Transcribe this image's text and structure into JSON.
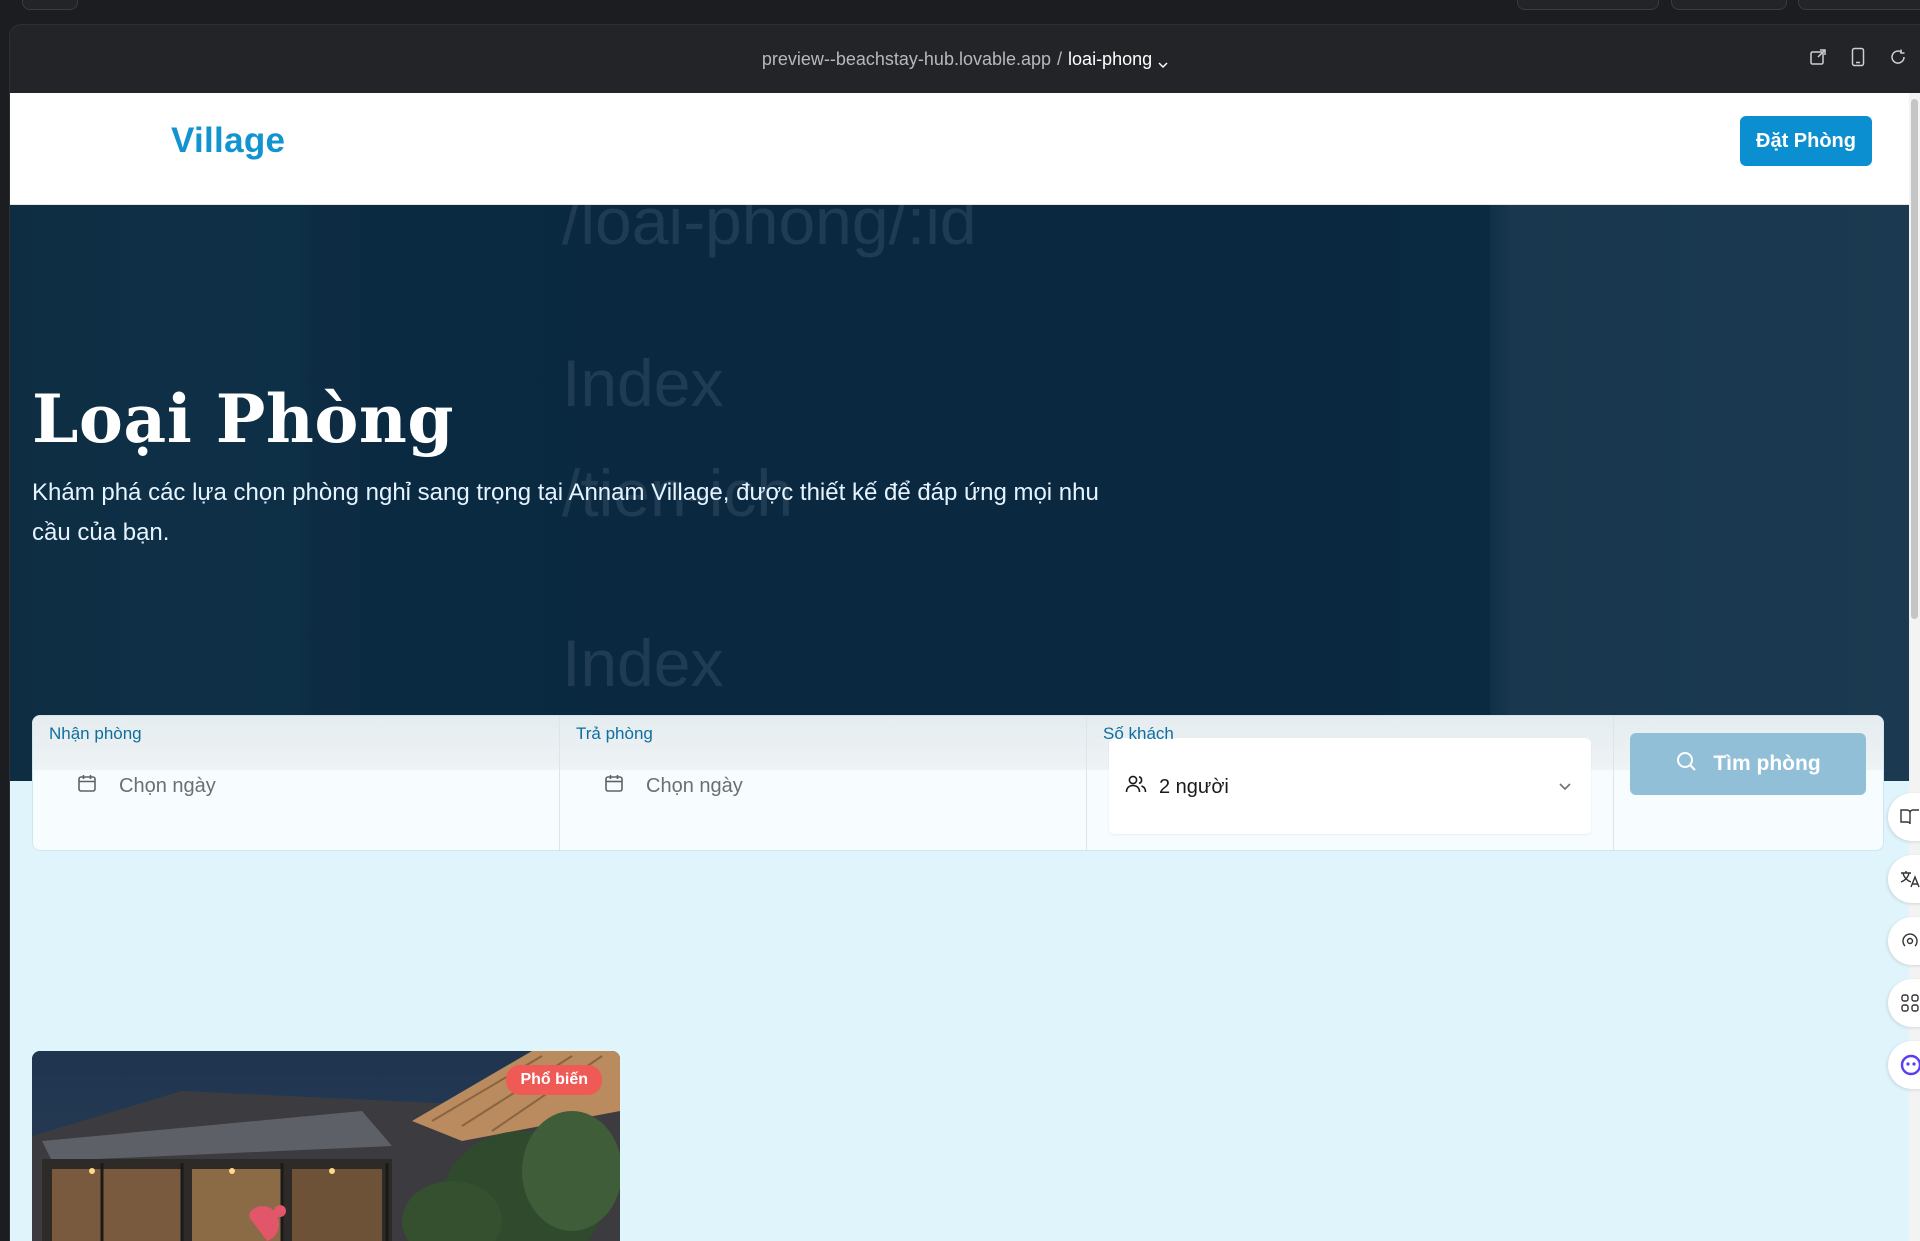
{
  "browser": {
    "url_host": "preview--beachstay-hub.lovable.app",
    "url_separator": "/",
    "url_path": "loai-phong"
  },
  "header": {
    "logo": "Village",
    "book_button": "Đặt Phòng"
  },
  "hero": {
    "title": "Loại Phòng",
    "subtitle": "Khám phá các lựa chọn phòng nghỉ sang trọng tại Annam Village, được thiết kế để đáp ứng mọi nhu cầu của bạn.",
    "ghost_texts": [
      "/loai-phong/:id",
      "Index",
      "/tien-ich",
      "Index"
    ]
  },
  "search": {
    "checkin_label": "Nhận phòng",
    "checkin_placeholder": "Chọn ngày",
    "checkout_label": "Trả phòng",
    "checkout_placeholder": "Chọn ngày",
    "guests_label": "Số khách",
    "guests_value": "2 người",
    "submit_label": "Tìm phòng"
  },
  "rooms": [
    {
      "badge": "Phổ biến"
    }
  ],
  "colors": {
    "brand": "#0b8fd0",
    "hero_bg": "#0a2a42",
    "page_bg": "#e0f5fb",
    "badge": "#ef5a56",
    "search_button": "#92bfd8"
  }
}
